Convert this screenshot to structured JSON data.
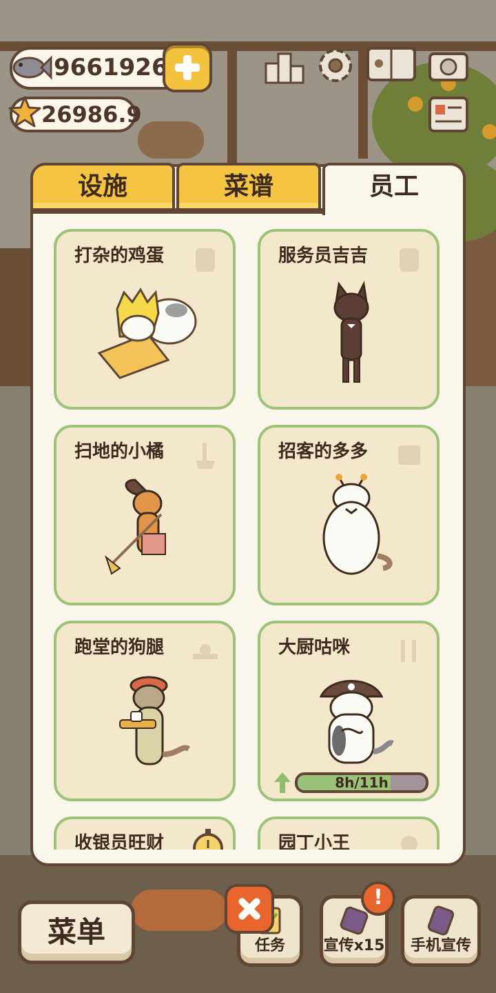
{
  "hud": {
    "fish_count": "9661926",
    "star_count": "26986.9",
    "icons": [
      "fish-icon",
      "star-icon",
      "plus-icon",
      "ranking-icon",
      "settings-gear-icon",
      "cat-book-icon",
      "camera-icon",
      "news-icon"
    ]
  },
  "tabs": [
    {
      "label": "设施",
      "active": false
    },
    {
      "label": "菜谱",
      "active": false
    },
    {
      "label": "员工",
      "active": true
    }
  ],
  "staff": [
    {
      "name": "打杂的鸡蛋",
      "icon": "cup-icon"
    },
    {
      "name": "服务员吉吉",
      "icon": "cup-icon"
    },
    {
      "name": "扫地的小橘",
      "icon": "broom-icon"
    },
    {
      "name": "招客的多多",
      "icon": "flyer-icon"
    },
    {
      "name": "跑堂的狗腿",
      "icon": "tray-icon"
    },
    {
      "name": "大厨咕咪",
      "icon": "utensils-icon",
      "progress_text": "8h/11h",
      "progress": 0.727
    },
    {
      "name": "收银员旺财",
      "icon": "stopwatch-icon"
    },
    {
      "name": "园丁小王",
      "icon": "plant-icon"
    }
  ],
  "bottom": {
    "menu_label": "菜单",
    "task_label": "任务",
    "promo_label": "宣传x15",
    "phone_promo_label": "手机宣传",
    "alert_text": "!"
  },
  "colors": {
    "accent_yellow": "#f6c443",
    "card_border": "#9dc27a",
    "outline": "#5e4534",
    "close_orange": "#e8652d"
  }
}
